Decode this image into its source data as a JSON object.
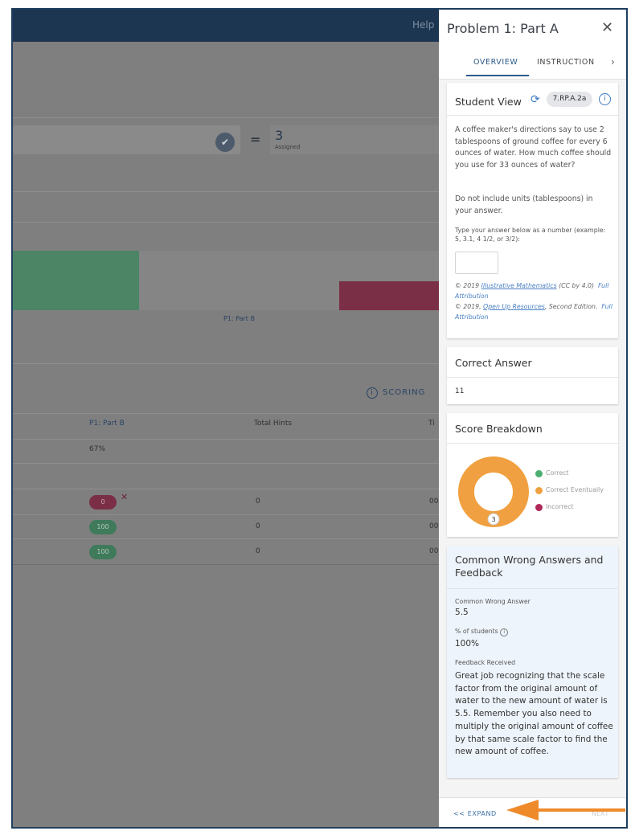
{
  "topbar": {
    "help_label": "Help"
  },
  "background": {
    "assigned_count": "3",
    "assigned_label": "Assigned",
    "bar_label": "P1: Part B",
    "scoring_label": "SCORING",
    "table": {
      "headers": [
        "P1: Part B",
        "Total Hints",
        "Ti"
      ],
      "average_row": {
        "score": "67%"
      },
      "rows": [
        {
          "score": "0",
          "hints": "0",
          "time": "00"
        },
        {
          "score": "100",
          "hints": "0",
          "time": "00"
        },
        {
          "score": "100",
          "hints": "0",
          "time": "00"
        }
      ]
    }
  },
  "panel": {
    "title": "Problem 1: Part A",
    "close_glyph": "✕",
    "tabs": [
      {
        "label": "OVERVIEW",
        "active": true
      },
      {
        "label": "INSTRUCTION"
      }
    ],
    "tab_arrow": "›",
    "student_view": {
      "title": "Student View",
      "standard_tag": "7.RP.A.2a",
      "question": "A coffee maker's directions say to use 2 tablespoons of ground coffee for every 6 ounces of water. How much coffee should you use for 33 ounces of water?",
      "note": "Do not include units (tablespoons) in your answer.",
      "answer_prompt": "Type your answer below as a number (example: 5, 3.1, 4 1/2, or 3/2):",
      "attribution_1_prefix": "© 2019 ",
      "attribution_1_link": "Illustrative Mathematics",
      "attribution_1_suffix": " (CC by 4.0)",
      "attribution_1_full": "Full Attribution",
      "attribution_2_prefix": "© 2019, ",
      "attribution_2_link": "Open Up Resources",
      "attribution_2_suffix": ", Second Edition.",
      "attribution_2_full": "Full Attribution"
    },
    "correct_answer": {
      "title": "Correct Answer",
      "value": "11"
    },
    "score_breakdown": {
      "title": "Score Breakdown",
      "center_label": "3",
      "legend": [
        "Correct",
        "Correct Eventually",
        "Incorrect"
      ],
      "colors": {
        "correct": "#4caf72",
        "eventually": "#f0a040",
        "incorrect": "#b0275a"
      }
    },
    "common_wrong": {
      "title": "Common Wrong Answers and Feedback",
      "answer_label": "Common Wrong Answer",
      "answer_value": "5.5",
      "percent_label": "% of students",
      "percent_value": "100%",
      "feedback_label": "Feedback Received",
      "feedback_text": "Great job recognizing that the scale factor from the original amount of water to the new amount of water is 5.5.  Remember you also need to multiply the original amount of coffee by that same scale factor to find the new amount of coffee."
    },
    "footer": {
      "expand_label": "<< EXPAND",
      "next_label": "NEXT"
    }
  },
  "chart_data": {
    "type": "pie",
    "title": "Score Breakdown",
    "categories": [
      "Correct",
      "Correct Eventually",
      "Incorrect"
    ],
    "values": [
      0,
      3,
      0
    ]
  }
}
